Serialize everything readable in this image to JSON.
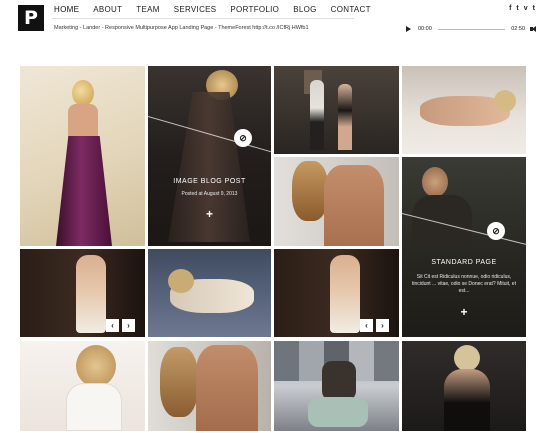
{
  "brand": {
    "logo_letter": "P"
  },
  "nav": {
    "items": [
      {
        "label": "HOME"
      },
      {
        "label": "ABOUT"
      },
      {
        "label": "TEAM"
      },
      {
        "label": "SERVICES"
      },
      {
        "label": "PORTFOLIO"
      },
      {
        "label": "BLOG"
      },
      {
        "label": "CONTACT"
      }
    ]
  },
  "social": {
    "facebook": "f",
    "twitter": "t",
    "vimeo": "v",
    "tumblr": "t"
  },
  "ticker": {
    "text": "Marketing - Lander - Responsive Multipurpose App Landing Page - ThemeForest http://t.co /ICfRj HWfb1"
  },
  "player": {
    "time_current": "00:00",
    "time_total": "02:50",
    "progress": 0
  },
  "posts": {
    "image": {
      "title": "IMAGE BLOG POST",
      "meta": "Posted at August 9, 2013",
      "plus": "+",
      "link_icon": "⊘"
    },
    "standard": {
      "title": "STANDARD PAGE",
      "excerpt": "Sit Cit est Ridiculus nonnue, odio ridiculus, tincidunt ... vitae, odio se Donec erat?  Mituit, et est...",
      "plus": "+",
      "link_icon": "⊘"
    },
    "gallery1": {
      "prev": "‹",
      "next": "›"
    },
    "gallery2": {
      "prev": "‹",
      "next": "›"
    }
  }
}
